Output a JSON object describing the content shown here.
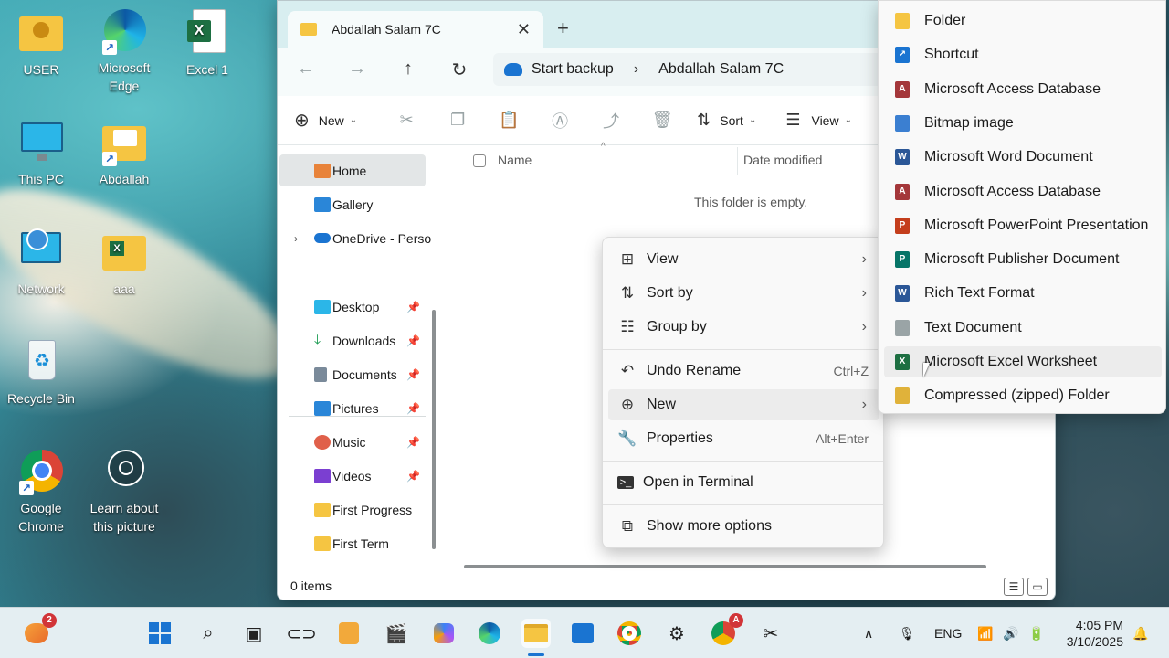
{
  "desktop": {
    "icons": [
      {
        "label": "USER"
      },
      {
        "label": "Microsoft Edge"
      },
      {
        "label": "Excel 1"
      },
      {
        "label": "This PC"
      },
      {
        "label": "Abdallah"
      },
      {
        "label": "Network"
      },
      {
        "label": "aaa"
      },
      {
        "label": "Recycle Bin"
      },
      {
        "label": "Google Chrome"
      },
      {
        "label": "Learn about this picture"
      }
    ]
  },
  "explorer": {
    "tab_title": "Abdallah Salam 7C",
    "address": {
      "backup_label": "Start backup",
      "current": "Abdallah Salam 7C"
    },
    "toolbar": {
      "new_label": "New",
      "sort_label": "Sort",
      "view_label": "View"
    },
    "sidebar": {
      "items": [
        {
          "label": "Home"
        },
        {
          "label": "Gallery"
        },
        {
          "label": "OneDrive - Perso"
        },
        {
          "label": "Desktop"
        },
        {
          "label": "Downloads"
        },
        {
          "label": "Documents"
        },
        {
          "label": "Pictures"
        },
        {
          "label": "Music"
        },
        {
          "label": "Videos"
        },
        {
          "label": "First Progress"
        },
        {
          "label": "First Term"
        }
      ]
    },
    "columns": {
      "name": "Name",
      "date": "Date modified"
    },
    "empty_text": "This folder is empty.",
    "status": "0 items"
  },
  "context_menu": {
    "items": [
      {
        "label": "View",
        "shortcut": ""
      },
      {
        "label": "Sort by",
        "shortcut": ""
      },
      {
        "label": "Group by",
        "shortcut": ""
      },
      {
        "label": "Undo Rename",
        "shortcut": "Ctrl+Z"
      },
      {
        "label": "New",
        "shortcut": ""
      },
      {
        "label": "Properties",
        "shortcut": "Alt+Enter"
      },
      {
        "label": "Open in Terminal",
        "shortcut": ""
      },
      {
        "label": "Show more options",
        "shortcut": ""
      }
    ]
  },
  "new_submenu": {
    "items": [
      {
        "label": "Folder",
        "color": "#f5c542"
      },
      {
        "label": "Shortcut",
        "color": "#1a74d1"
      },
      {
        "label": "Microsoft Access Database",
        "color": "#a4373a"
      },
      {
        "label": "Bitmap image",
        "color": "#3b7fd1"
      },
      {
        "label": "Microsoft Word Document",
        "color": "#2b5797"
      },
      {
        "label": "Microsoft Access Database",
        "color": "#a4373a"
      },
      {
        "label": "Microsoft PowerPoint Presentation",
        "color": "#c43e1c"
      },
      {
        "label": "Microsoft Publisher Document",
        "color": "#077568"
      },
      {
        "label": "Rich Text Format",
        "color": "#2b5797"
      },
      {
        "label": "Text Document",
        "color": "#9aa4a6"
      },
      {
        "label": "Microsoft Excel Worksheet",
        "color": "#1d6f42"
      },
      {
        "label": "Compressed (zipped) Folder",
        "color": "#e0b23a"
      }
    ]
  },
  "taskbar": {
    "weather_badge": "2",
    "chrome_badge": "A",
    "language": "ENG",
    "time": "4:05 PM",
    "date": "3/10/2025"
  }
}
